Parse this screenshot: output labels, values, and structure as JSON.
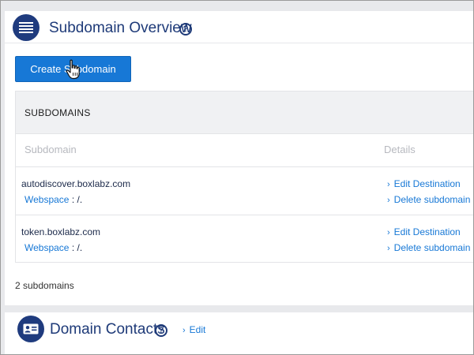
{
  "subdomain_overview": {
    "title": "Subdomain Overview",
    "help": "?",
    "create_button": "Create Subdomain",
    "table": {
      "heading": "SUBDOMAINS",
      "columns": [
        "Subdomain",
        "Details"
      ],
      "rows": [
        {
          "name": "autodiscover.boxlabz.com",
          "webspace_label": "Webspace",
          "webspace_value": " : /.",
          "actions": [
            "Edit Destination",
            "Delete subdomain"
          ]
        },
        {
          "name": "token.boxlabz.com",
          "webspace_label": "Webspace",
          "webspace_value": " : /.",
          "actions": [
            "Edit Destination",
            "Delete subdomain"
          ]
        }
      ]
    },
    "count": "2 subdomains"
  },
  "domain_contacts": {
    "title": "Domain Contacts",
    "help": "?",
    "edit": "Edit"
  },
  "icons": {
    "overview": "list-lines-icon",
    "contacts": "contact-card-icon",
    "chevron": "chevron-right-icon",
    "cursor": "hand-pointer-icon"
  },
  "colors": {
    "navy": "#1f3b7e",
    "button": "#1778d6",
    "link": "#1778d6"
  }
}
